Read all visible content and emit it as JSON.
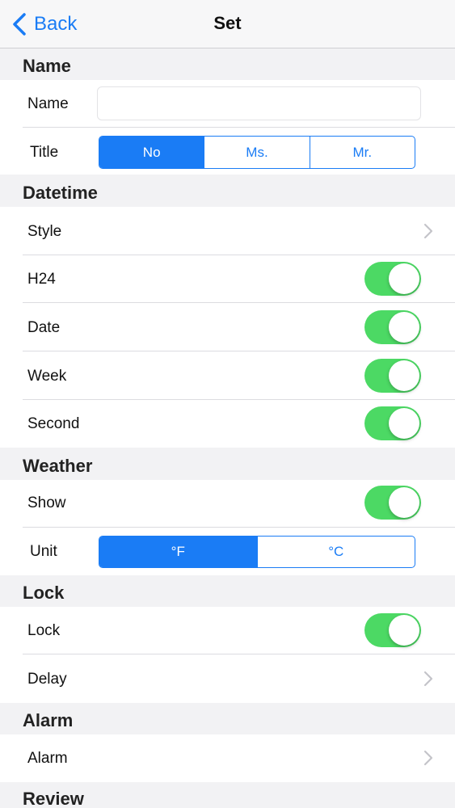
{
  "nav": {
    "back_label": "Back",
    "title": "Set"
  },
  "sections": {
    "name": "Name",
    "datetime": "Datetime",
    "weather": "Weather",
    "lock": "Lock",
    "alarm": "Alarm",
    "review": "Review"
  },
  "name_row": {
    "label": "Name",
    "value": "",
    "placeholder": ""
  },
  "title_row": {
    "label": "Title",
    "options": [
      "No",
      "Ms.",
      "Mr."
    ],
    "selected": "No"
  },
  "datetime_rows": {
    "style": "Style",
    "h24": {
      "label": "H24",
      "on": true
    },
    "date": {
      "label": "Date",
      "on": true
    },
    "week": {
      "label": "Week",
      "on": true
    },
    "second": {
      "label": "Second",
      "on": true
    }
  },
  "weather_rows": {
    "show": {
      "label": "Show",
      "on": true
    },
    "unit": {
      "label": "Unit",
      "options": [
        "°F",
        "°C"
      ],
      "selected": "°F"
    }
  },
  "lock_rows": {
    "lock": {
      "label": "Lock",
      "on": true
    },
    "delay": "Delay"
  },
  "alarm_rows": {
    "alarm": "Alarm"
  },
  "colors": {
    "accent": "#1a7cf5",
    "toggle_on": "#4cd964",
    "background": "#f2f2f4"
  }
}
